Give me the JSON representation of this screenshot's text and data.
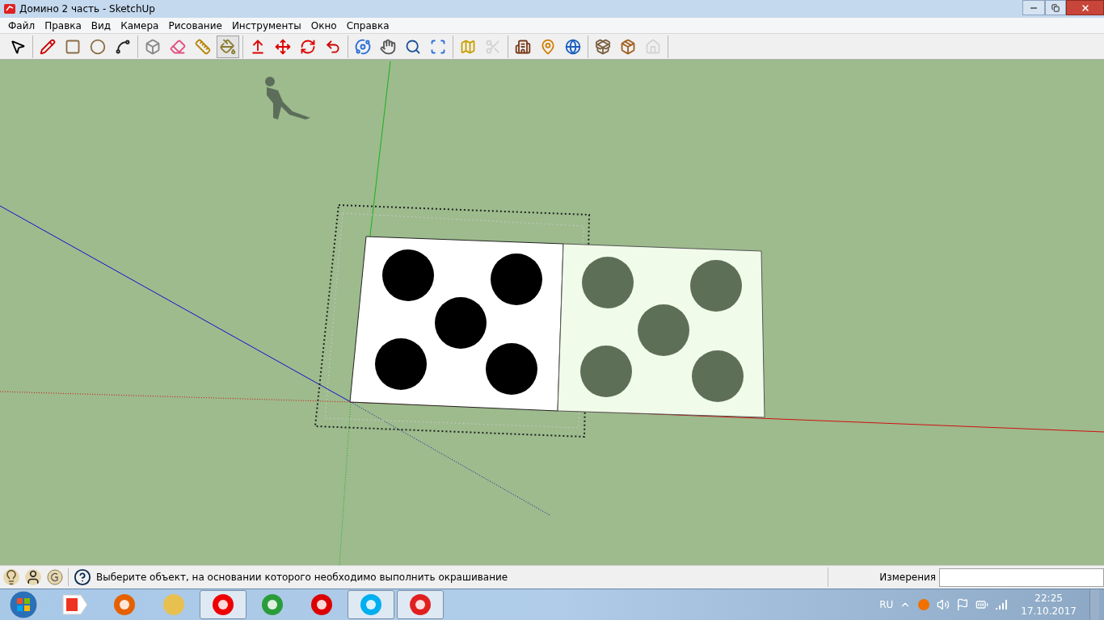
{
  "window": {
    "title": "Домино 2 часть - SketchUp"
  },
  "menu": [
    "Файл",
    "Правка",
    "Вид",
    "Камера",
    "Рисование",
    "Инструменты",
    "Окно",
    "Справка"
  ],
  "toolbar": [
    [
      {
        "selected": false,
        "disabled": false
      }
    ],
    [
      {
        "selected": false,
        "disabled": false
      },
      {
        "selected": false,
        "disabled": false
      },
      {
        "selected": false,
        "disabled": false
      },
      {
        "selected": false,
        "disabled": false
      }
    ],
    [
      {
        "selected": false,
        "disabled": false
      },
      {
        "selected": false,
        "disabled": false
      },
      {
        "selected": false,
        "disabled": false
      },
      {
        "selected": true,
        "disabled": false
      }
    ],
    [
      {
        "selected": false,
        "disabled": false
      },
      {
        "selected": false,
        "disabled": false
      },
      {
        "selected": false,
        "disabled": false
      },
      {
        "selected": false,
        "disabled": false
      }
    ],
    [
      {
        "selected": false,
        "disabled": false
      },
      {
        "selected": false,
        "disabled": false
      },
      {
        "selected": false,
        "disabled": false
      },
      {
        "selected": false,
        "disabled": false
      }
    ],
    [
      {
        "selected": false,
        "disabled": false
      },
      {
        "selected": false,
        "disabled": true
      }
    ],
    [
      {
        "selected": false,
        "disabled": false
      },
      {
        "selected": false,
        "disabled": false
      },
      {
        "selected": false,
        "disabled": false
      }
    ],
    [
      {
        "selected": false,
        "disabled": false
      },
      {
        "selected": false,
        "disabled": false
      },
      {
        "selected": false,
        "disabled": true
      }
    ]
  ],
  "status_bar": {
    "message": "Выберите объект, на основании которого необходимо выполнить окрашивание",
    "measurements_label": "Измерения"
  },
  "taskbar": {
    "apps": [
      {
        "open": false
      },
      {
        "open": false
      },
      {
        "open": false
      },
      {
        "open": true
      },
      {
        "open": false
      },
      {
        "open": false
      },
      {
        "open": true
      },
      {
        "open": true
      }
    ],
    "language": "RU",
    "time": "22:25",
    "date": "17.10.2017"
  }
}
